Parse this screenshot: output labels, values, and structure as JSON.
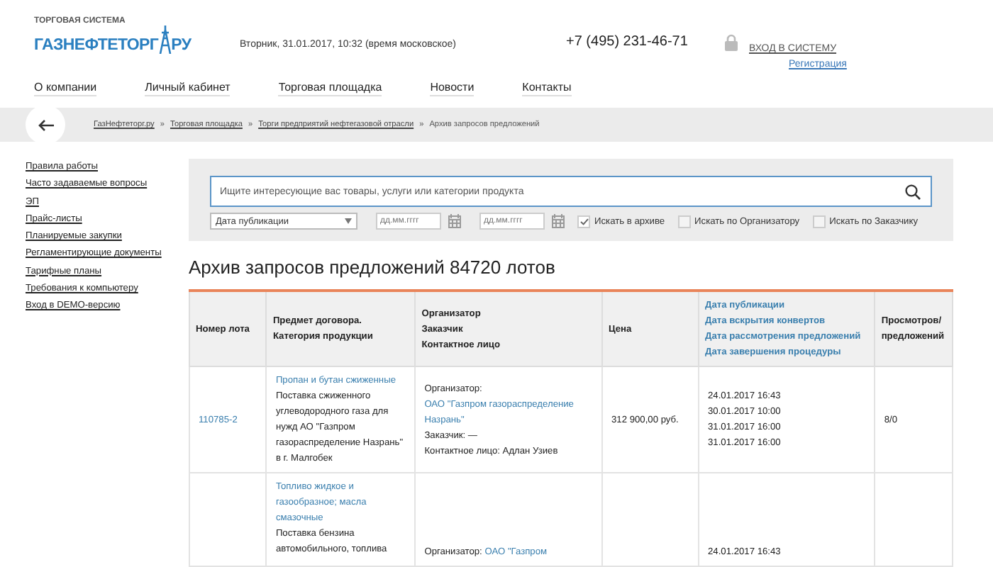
{
  "header": {
    "tagline": "ТОРГОВАЯ СИСТЕМА",
    "logo_main": "ГАЗНЕФТЕТОРГ",
    "logo_suffix": "РУ",
    "datetime": "Вторник, 31.01.2017, 10:32 (время московское)",
    "phone": "+7 (495) 231-46-71",
    "login": "ВХОД В СИСТЕМУ",
    "register": "Регистрация"
  },
  "nav": [
    "О компании",
    "Личный кабинет",
    "Торговая площадка",
    "Новости",
    "Контакты"
  ],
  "breadcrumb_separator": "»",
  "breadcrumbs": [
    {
      "label": "ГазНефтеторг.ру",
      "link": true
    },
    {
      "label": "Торговая площадка",
      "link": true
    },
    {
      "label": "Торги предприятий нефтегазовой отрасли",
      "link": true
    },
    {
      "label": "Архив запросов предложений",
      "link": false
    }
  ],
  "sidebar": {
    "items": [
      "Правила работы",
      "Часто задаваемые вопросы",
      "ЭП",
      "Прайс-листы",
      "Планируемые закупки",
      "Регламентирующие документы",
      "Тарифные планы",
      "Требования к компьютеру",
      "Вход в DEMO-версию"
    ]
  },
  "search": {
    "placeholder": "Ищите интересующие вас товары, услуги или категории продукта",
    "date_type": "Дата публикации",
    "date_from": {
      "placeholder": "дд.мм.гггг"
    },
    "date_to": {
      "placeholder": "дд.мм.гггг"
    },
    "options": [
      {
        "label": "Искать в архиве",
        "checked": true
      },
      {
        "label": "Искать по Организатору",
        "checked": false
      },
      {
        "label": "Искать по Заказчику",
        "checked": false
      }
    ]
  },
  "title": "Архив запросов предложений 84720 лотов",
  "table": {
    "columns": [
      {
        "lines": [
          "Номер лота"
        ],
        "link": false
      },
      {
        "lines": [
          "Предмет договора.",
          "Категория продукции"
        ],
        "link": false
      },
      {
        "lines": [
          "Организатор",
          "Заказчик",
          "Контактное лицо"
        ],
        "link": false
      },
      {
        "lines": [
          "Цена"
        ],
        "link": false
      },
      {
        "lines": [
          "Дата публикации",
          "Дата вскрытия конвертов",
          "Дата рассмотрения предложений",
          "Дата завершения процедуры"
        ],
        "link": true
      },
      {
        "lines": [
          "Просмотров/",
          "предложений"
        ],
        "link": false
      }
    ],
    "rows": [
      {
        "lot": "110785-2",
        "category": "Пропан и бутан сжиженные",
        "subject": "Поставка сжиженного углеводородного газа для нужд АО \"Газпром газораспределение Назрань\" в г. Малгобек",
        "organizer_label": "Организатор:",
        "organizer": "ОАО \"Газпром газораспределение Назрань\"",
        "customer": "Заказчик: —",
        "contact": "Контактное лицо: Адлан Узиев",
        "price": "312 900,00 руб.",
        "dates": [
          "24.01.2017 16:43",
          "30.01.2017 10:00",
          "31.01.2017 16:00",
          "31.01.2017 16:00"
        ],
        "views": "8/0"
      },
      {
        "category": "Топливо жидкое и газообразное; масла смазочные",
        "subject": "Поставка бензина автомобильного, топлива",
        "organizer_label": "Организатор:",
        "organizer": "ОАО \"Газпром",
        "dates": [
          "24.01.2017 16:43"
        ]
      }
    ]
  }
}
